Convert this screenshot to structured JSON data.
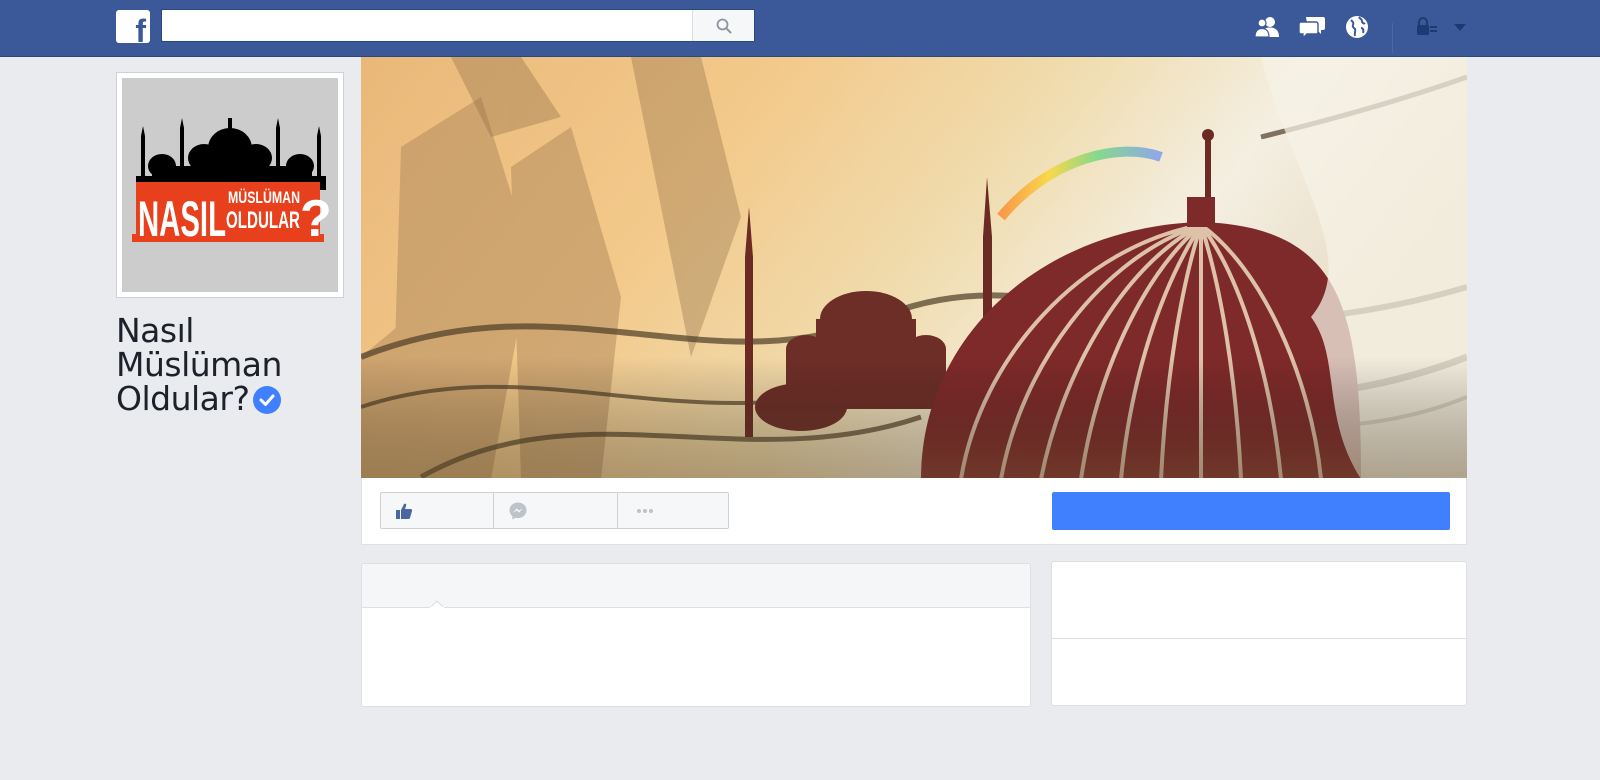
{
  "app": {
    "brand_letter": "f"
  },
  "search": {
    "placeholder": "",
    "value": ""
  },
  "header_icons": [
    "friends-icon",
    "messages-icon",
    "notifications-globe-icon",
    "privacy-lock-icon",
    "account-dropdown-icon"
  ],
  "profile": {
    "logo_text_top": "MÜSLÜMAN",
    "logo_text_main": "NASIL",
    "logo_text_sub": "OLDULAR",
    "logo_text_mark": "?",
    "name": "Nasıl Müslüman Oldular?",
    "verified": true
  },
  "action_bar": {
    "buttons": [
      {
        "icon": "like-thumb-icon",
        "label": ""
      },
      {
        "icon": "messenger-icon",
        "label": ""
      },
      {
        "icon": "more-dots-icon",
        "label": ""
      }
    ],
    "cta_label": ""
  },
  "composer": {
    "header": "",
    "body": ""
  },
  "colors": {
    "brand": "#3b5998",
    "accent": "#4080ff",
    "background": "#e9ebee"
  }
}
